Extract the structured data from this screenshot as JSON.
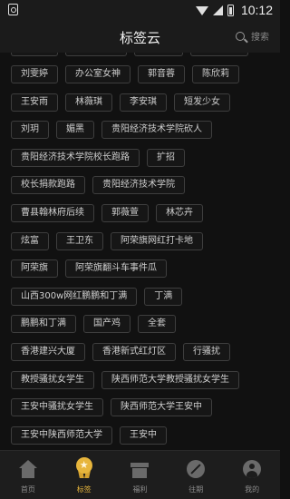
{
  "status_bar": {
    "time": "10:12"
  },
  "header": {
    "title": "标签云",
    "search_label": "搜索"
  },
  "tag_rows": [
    [
      "刘雯婷",
      "办公室女神",
      "郭音蓉",
      "陈欣莉"
    ],
    [
      "王安雨",
      "林薇琪",
      "李安琪",
      "短发少女"
    ],
    [
      "刘玥",
      "媚黑",
      "贵阳经济技术学院砍人"
    ],
    [
      "贵阳经济技术学院校长跑路",
      "扩招"
    ],
    [
      "校长捐款跑路",
      "贵阳经济技术学院"
    ],
    [
      "曹县翰林府后续",
      "郭薇萱",
      "林芯卉"
    ],
    [
      "炫富",
      "王卫东",
      "阿荣旗网红打卡地"
    ],
    [
      "阿荣旗",
      "阿荣旗翻斗车事件瓜"
    ],
    [
      "山西300w网红鹏鹏和丁满",
      "丁满"
    ],
    [
      "鹏鹏和丁满",
      "国产鸡",
      "全套"
    ],
    [
      "香港建兴大厦",
      "香港新式红灯区",
      "行骚扰"
    ],
    [
      "教授骚扰女学生",
      "陕西师范大学教授骚扰女学生"
    ],
    [
      "王安中骚扰女学生",
      "陕西师范大学王安中"
    ],
    [
      "王安中陕西师范大学",
      "王安中"
    ]
  ],
  "tabbar": {
    "items": [
      {
        "label": "首页",
        "icon": "home-icon",
        "active": false
      },
      {
        "label": "标签",
        "icon": "badge-icon",
        "active": true
      },
      {
        "label": "福利",
        "icon": "gift-icon",
        "active": false
      },
      {
        "label": "往期",
        "icon": "compass-icon",
        "active": false
      },
      {
        "label": "我的",
        "icon": "person-icon",
        "active": false
      }
    ]
  },
  "colors": {
    "accent": "#e7b53c",
    "background": "#111111",
    "bar": "#1b1b1b"
  }
}
